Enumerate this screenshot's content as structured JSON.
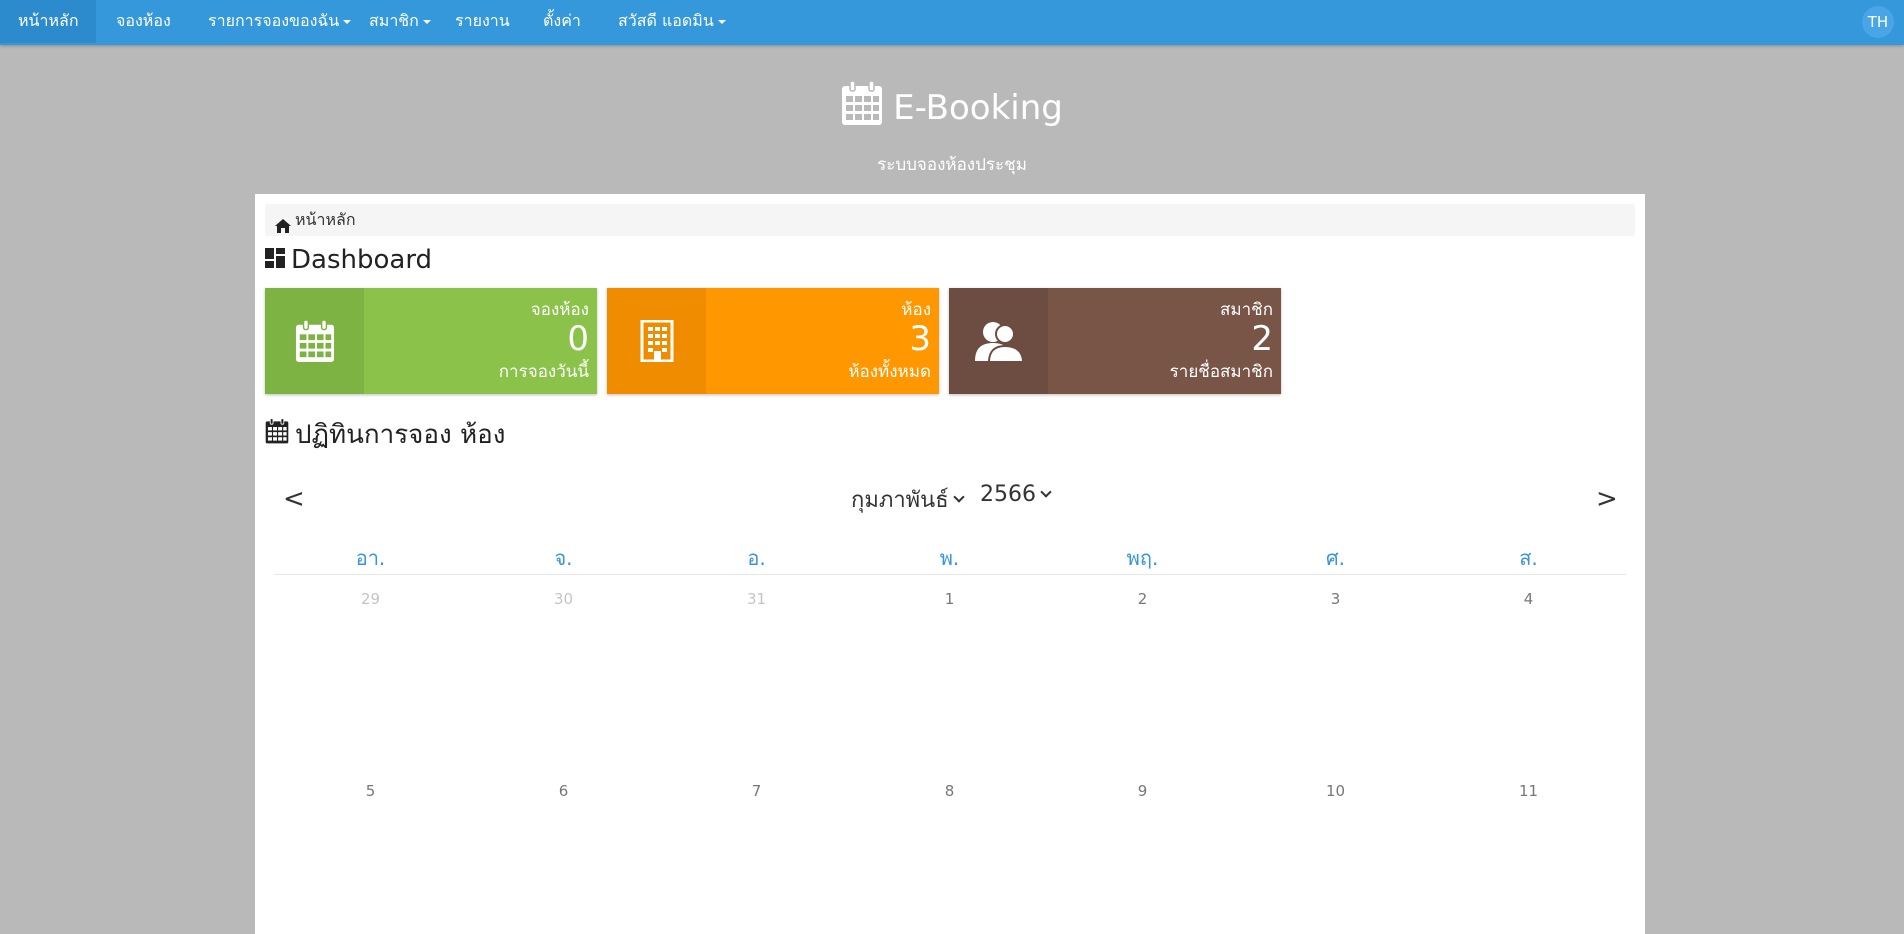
{
  "nav": {
    "items": [
      {
        "label": "หน้าหลัก",
        "active": true
      },
      {
        "label": "จองห้อง"
      },
      {
        "label": "รายการจองของฉัน",
        "dropdown": true
      },
      {
        "label": "สมาชิก",
        "dropdown": true
      },
      {
        "label": "รายงาน"
      },
      {
        "label": "ตั้งค่า"
      },
      {
        "label": "สวัสดี แอดมิน",
        "dropdown": true
      }
    ],
    "lang": "TH"
  },
  "brand": {
    "title": "E-Booking",
    "subtitle": "ระบบจองห้องประชุม",
    "icon": "calendar-icon"
  },
  "breadcrumb": {
    "label": "หน้าหลัก",
    "icon": "home-icon"
  },
  "dashboard": {
    "heading": "Dashboard",
    "icon": "dashboard-icon",
    "tiles": [
      {
        "label": "จองห้อง",
        "value": "0",
        "sub": "การจองวันนี้",
        "icon": "calendar-icon",
        "color": "#8bc34a",
        "icon_bg": "#7cb342"
      },
      {
        "label": "ห้อง",
        "value": "3",
        "sub": "ห้องทั้งหมด",
        "icon": "building-icon",
        "color": "#ff9800",
        "icon_bg": "#f08c00"
      },
      {
        "label": "สมาชิก",
        "value": "2",
        "sub": "รายชื่อสมาชิก",
        "icon": "users-icon",
        "color": "#795548",
        "icon_bg": "#6d4c41"
      }
    ]
  },
  "calendar": {
    "heading": "ปฏิทินการจอง ห้อง",
    "icon": "calendar-icon",
    "prev": "<",
    "next": ">",
    "month": "กุมภาพันธ์",
    "year": "2566",
    "weekdays": [
      "อา.",
      "จ.",
      "อ.",
      "พ.",
      "พฤ.",
      "ศ.",
      "ส."
    ],
    "weeks": [
      [
        {
          "d": "29",
          "muted": true
        },
        {
          "d": "30",
          "muted": true
        },
        {
          "d": "31",
          "muted": true
        },
        {
          "d": "1"
        },
        {
          "d": "2"
        },
        {
          "d": "3"
        },
        {
          "d": "4"
        }
      ],
      [
        {
          "d": "5"
        },
        {
          "d": "6"
        },
        {
          "d": "7"
        },
        {
          "d": "8"
        },
        {
          "d": "9"
        },
        {
          "d": "10"
        },
        {
          "d": "11"
        }
      ]
    ]
  }
}
